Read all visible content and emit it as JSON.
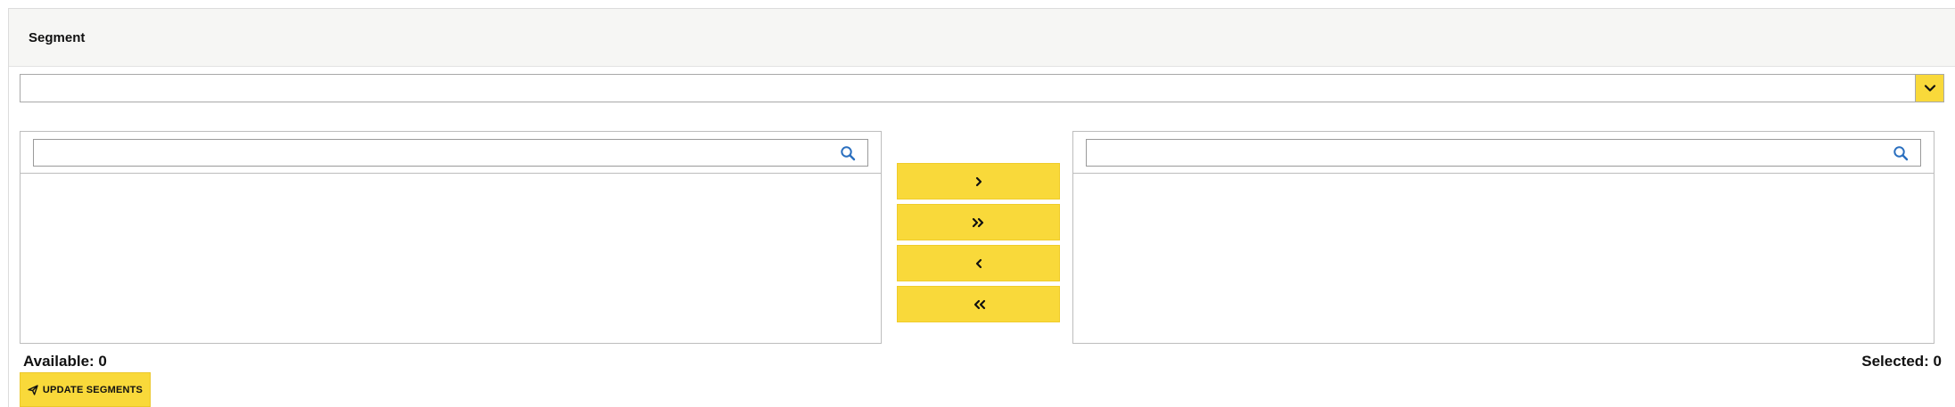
{
  "panel": {
    "title": "Segment"
  },
  "segment_dropdown": {
    "selected_value": "",
    "toggle_icon": "chevron-down-icon"
  },
  "available_list": {
    "search_value": "",
    "search_placeholder": "",
    "search_icon": "search-icon",
    "items": [],
    "count_label": "Available: 0"
  },
  "selected_list": {
    "search_value": "",
    "search_placeholder": "",
    "search_icon": "search-icon",
    "items": [],
    "count_label": "Selected: 0"
  },
  "transfer_buttons": [
    {
      "name": "move-selected-right",
      "icon": "chevron-right-icon"
    },
    {
      "name": "move-all-right",
      "icon": "double-chevron-right-icon"
    },
    {
      "name": "move-selected-left",
      "icon": "chevron-left-icon"
    },
    {
      "name": "move-all-left",
      "icon": "double-chevron-left-icon"
    }
  ],
  "update_button": {
    "label": "UPDATE SEGMENTS",
    "icon": "paper-plane-icon"
  },
  "colors": {
    "accent": "#f9d93a",
    "header_background": "#f6f6f4",
    "search_icon": "#2a6fbf",
    "border": "#bdbdbd"
  }
}
